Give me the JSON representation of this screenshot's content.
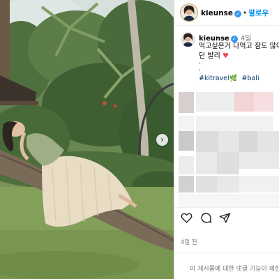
{
  "post": {
    "username": "kieunse",
    "follow_label": "팔로우",
    "caption_username": "kieunse",
    "caption_time": "4일",
    "caption_line1": "먹고싶은거 다먹고 잠도 많이",
    "caption_line2": "던 발리",
    "caption_dots": [
      ".",
      "."
    ],
    "hashtags": [
      "#kitravel🌿",
      "#bali"
    ],
    "post_time": "4일 전",
    "comments_notice": "이 게시물에 대한 댓글 기능이 제한"
  },
  "icons": {
    "verified": "verified-badge-icon",
    "heart": "heart-emoji-icon",
    "carousel_next": "chevron-right-icon",
    "like": "heart-outline-icon",
    "comment": "comment-icon",
    "share": "send-icon"
  },
  "colors": {
    "follow": "#0095f6",
    "verified": "#3897f0",
    "hashtag": "#00376b",
    "muted": "#737373",
    "heart_emoji": "#ed4956"
  },
  "glyphs": {
    "verified": "✓",
    "dot_sep": "•",
    "heart": "♥",
    "chevron": "›"
  }
}
